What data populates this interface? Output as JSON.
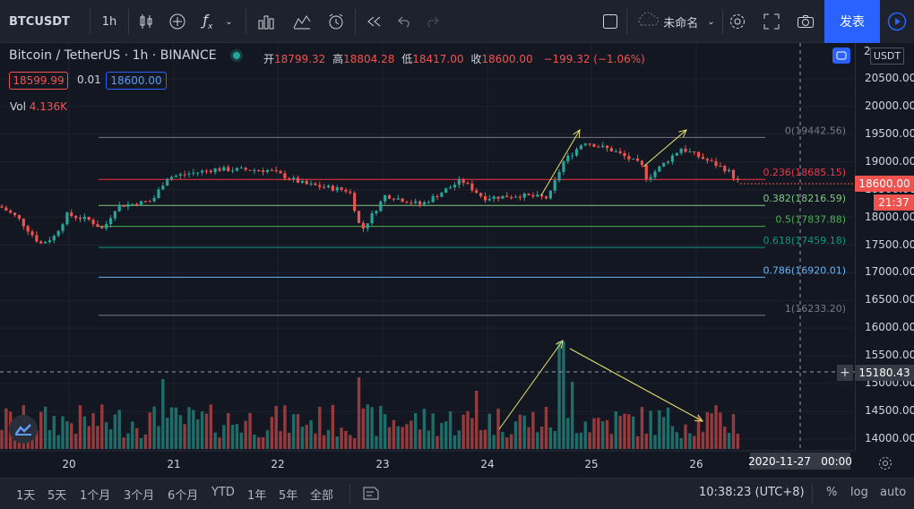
{
  "toolbar": {
    "symbol": "BTCUSDT",
    "interval": "1h",
    "layout_name": "未命名",
    "publish_label": "发表"
  },
  "legend": {
    "title": "Bitcoin / TetherUS · 1h · BINANCE",
    "open_label": "开",
    "open": "18799.32",
    "high_label": "高",
    "high": "18804.28",
    "low_label": "低",
    "low": "18417.00",
    "close_label": "收",
    "close": "18600.00",
    "change": "−199.32 (−1.06%)",
    "bid": "18599.99",
    "spread": "0.01",
    "ask": "18600.00",
    "vol_label": "Vol",
    "vol_value": "4.136K"
  },
  "price_axis": {
    "currency": "USDT",
    "ticks": [
      "20500.00",
      "20000.00",
      "19500.00",
      "19000.00",
      "18500.00",
      "18000.00",
      "17500.00",
      "17000.00",
      "16500.00",
      "16000.00",
      "15500.00",
      "15000.00",
      "14500.00",
      "14000.00"
    ],
    "top_tick": "2",
    "current_price": "18600.00",
    "countdown": "21:37",
    "crosshair_price": "15180.43"
  },
  "time_axis": {
    "ticks": [
      "20",
      "21",
      "22",
      "23",
      "24",
      "25",
      "26"
    ],
    "crosshair_time": "2020-11-27   00:00"
  },
  "fib": [
    {
      "label": "0(19442.56)",
      "color": "#787b86"
    },
    {
      "label": "0.236(18685.15)",
      "color": "#f23645"
    },
    {
      "label": "0.382(18216.59)",
      "color": "#81c784"
    },
    {
      "label": "0.5(17837.88)",
      "color": "#4caf50"
    },
    {
      "label": "0.618(17459.18)",
      "color": "#089981"
    },
    {
      "label": "0.786(16920.01)",
      "color": "#64b5f6"
    },
    {
      "label": "1(16233.20)",
      "color": "#787b86"
    }
  ],
  "bottom": {
    "ranges": [
      "1天",
      "5天",
      "1个月",
      "3个月",
      "6个月",
      "YTD",
      "1年",
      "5年",
      "全部"
    ],
    "clock": "10:38:23 (UTC+8)",
    "percent": "%",
    "log": "log",
    "auto": "auto"
  },
  "colors": {
    "up": "#26a69a",
    "down": "#ef5350",
    "accent": "#2962ff",
    "arrow": "#e5e56a"
  },
  "icons": [
    "candles-icon",
    "add-indicator-icon",
    "fx-indicators-icon",
    "bars-icon",
    "compare-icon",
    "alarm-icon",
    "replay-icon",
    "undo-icon",
    "redo-icon",
    "layout-icon",
    "cloud-icon",
    "settings-icon",
    "fullscreen-icon",
    "camera-icon",
    "play-icon",
    "trading-view-logo-icon",
    "settings-gear-icon",
    "date-range-icon"
  ]
}
